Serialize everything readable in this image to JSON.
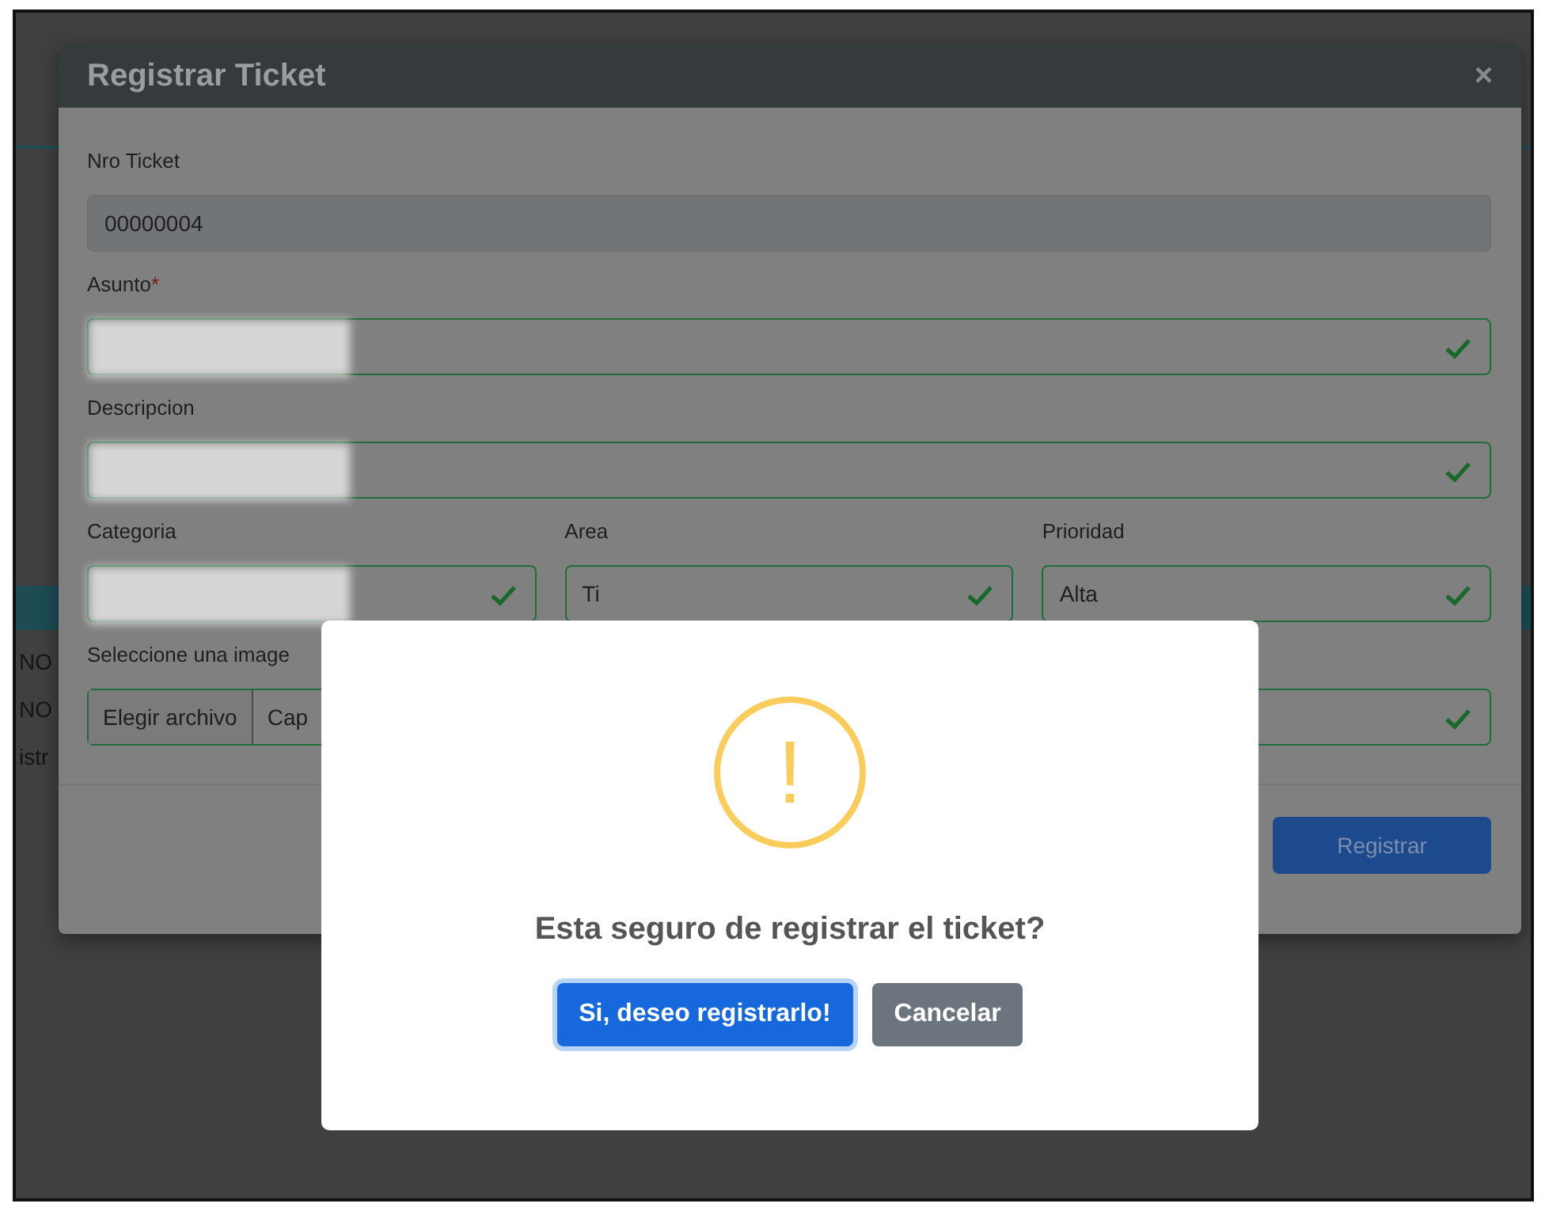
{
  "background": {
    "cells": [
      "NO",
      "NO"
    ],
    "footer_text": "istr"
  },
  "modal": {
    "title": "Registrar Ticket",
    "close": "×",
    "fields": [
      {
        "label": "Nro Ticket",
        "value": "00000004",
        "disabled": true,
        "valid": false
      },
      {
        "label": "Asunto",
        "required_mark": "*",
        "blurred": true,
        "disabled": false,
        "valid": true
      },
      {
        "label": "Descripcion",
        "blurred": true,
        "disabled": false,
        "valid": true
      }
    ],
    "selects": [
      {
        "label": "Categoria",
        "blurred": true,
        "valid": true
      },
      {
        "label": "Area",
        "value": "Ti",
        "valid": true
      },
      {
        "label": "Prioridad",
        "value": "Alta",
        "valid": true
      }
    ],
    "file": {
      "label": "Seleccione una image",
      "button": "Elegir archivo",
      "value": "Cap",
      "valid": true
    },
    "submit": "Registrar"
  },
  "dialog": {
    "icon": "!",
    "message": "Esta seguro de registrar el ticket?",
    "confirm": "Si, deseo registrarlo!",
    "cancel": "Cancelar"
  }
}
